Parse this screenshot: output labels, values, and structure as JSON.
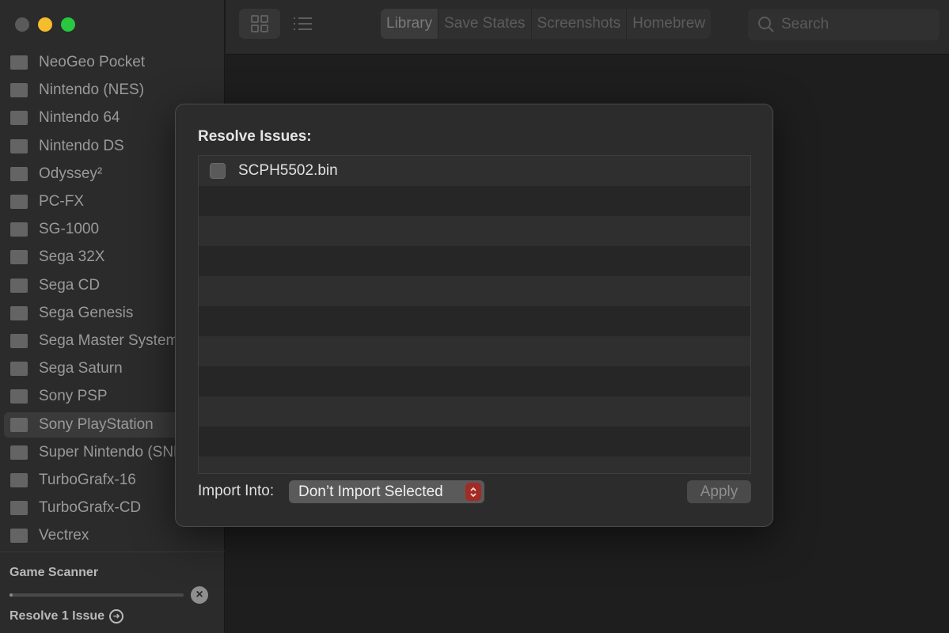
{
  "sidebar": {
    "systems": [
      {
        "label": "NeoGeo Pocket",
        "icon": "neogeo-pocket-icon"
      },
      {
        "label": "Nintendo (NES)",
        "icon": "nes-icon"
      },
      {
        "label": "Nintendo 64",
        "icon": "n64-icon"
      },
      {
        "label": "Nintendo DS",
        "icon": "nds-icon"
      },
      {
        "label": "Odyssey²",
        "icon": "odyssey-icon"
      },
      {
        "label": "PC-FX",
        "icon": "pc-fx-icon"
      },
      {
        "label": "SG-1000",
        "icon": "sg-1000-icon"
      },
      {
        "label": "Sega 32X",
        "icon": "sega-32x-icon"
      },
      {
        "label": "Sega CD",
        "icon": "sega-cd-icon"
      },
      {
        "label": "Sega Genesis",
        "icon": "sega-genesis-icon"
      },
      {
        "label": "Sega Master System",
        "icon": "sega-master-system-icon"
      },
      {
        "label": "Sega Saturn",
        "icon": "sega-saturn-icon"
      },
      {
        "label": "Sony PSP",
        "icon": "sony-psp-icon"
      },
      {
        "label": "Sony PlayStation",
        "icon": "sony-playstation-icon",
        "selected": true
      },
      {
        "label": "Super Nintendo (SNES)",
        "icon": "snes-icon"
      },
      {
        "label": "TurboGrafx-16",
        "icon": "turbografx-16-icon"
      },
      {
        "label": "TurboGrafx-CD",
        "icon": "turbografx-cd-icon"
      },
      {
        "label": "Vectrex",
        "icon": "vectrex-icon"
      }
    ],
    "scanner": {
      "title": "Game Scanner",
      "progress": 0.02,
      "resolve_label": "Resolve 1 Issue"
    }
  },
  "toolbar": {
    "tabs": [
      "Library",
      "Save States",
      "Screenshots",
      "Homebrew"
    ],
    "active_tab": 0,
    "search_placeholder": "Search"
  },
  "dialog": {
    "title": "Resolve Issues:",
    "files": [
      {
        "name": "SCPH5502.bin",
        "checked": false
      }
    ],
    "import_label": "Import Into:",
    "import_value": "Don’t Import Selected",
    "apply_label": "Apply"
  },
  "colors": {
    "traffic_close": "#5a5a5a",
    "traffic_minimize": "#f5bd2d",
    "traffic_maximize": "#28c840",
    "popup_accent": "#a32b25"
  }
}
